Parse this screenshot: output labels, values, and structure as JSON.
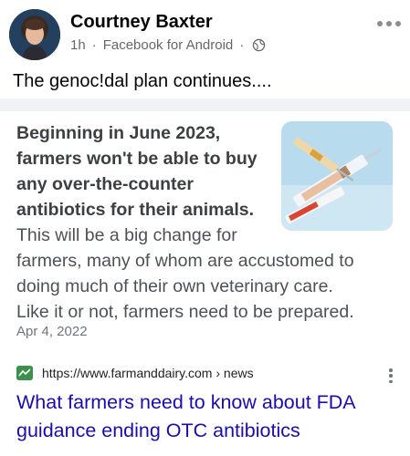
{
  "post": {
    "author": "Courtney Baxter",
    "time": "1h",
    "separator": "·",
    "source": "Facebook for Android",
    "text": "The genoc!dal plan continues...."
  },
  "icons": {
    "privacy": "globe-icon",
    "more": "more-horizontal-icon",
    "result_menu": "more-vertical-icon"
  },
  "card": {
    "snippet_bold_lines": [
      "Beginning in June 2023,",
      "farmers won't be able to buy",
      "any over-the-counter",
      "antibiotics for their animals."
    ],
    "snippet_rest_line1": "This will be a big change for",
    "snippet_rest_lines": [
      "farmers, many of whom are accustomed to",
      "doing much of their own veterinary care.",
      "Like it or not, farmers need to be prepared."
    ],
    "date": "Apr 4, 2022",
    "url": "https://www.farmanddairy.com › news",
    "title_lines": [
      "What farmers need to know about FDA",
      "guidance ending OTC antibiotics"
    ]
  },
  "colors": {
    "link": "#1a0dab",
    "meta": "#65676b",
    "snippet": "#4d5156"
  }
}
